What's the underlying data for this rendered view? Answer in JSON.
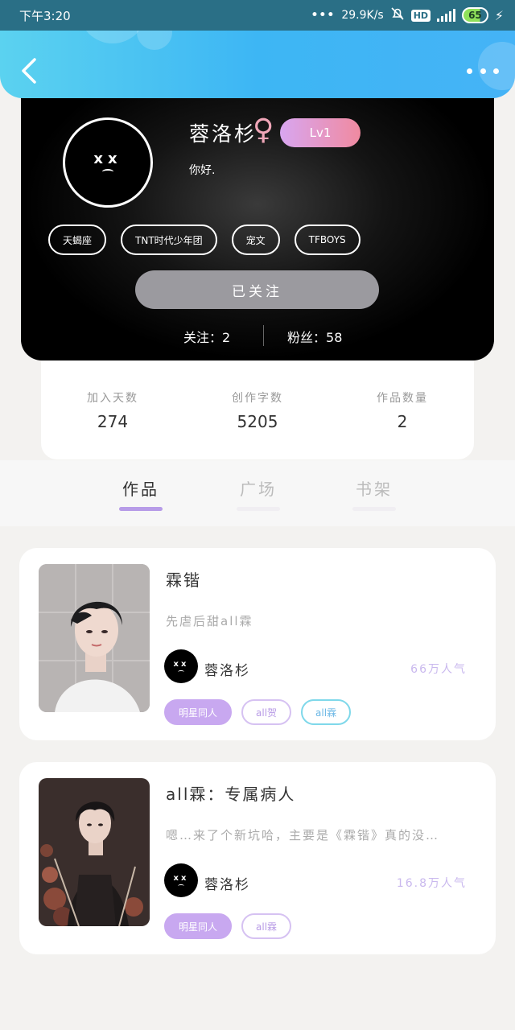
{
  "status_bar": {
    "time": "下午3:20",
    "network_speed": "29.9K/s",
    "hd": "HD",
    "battery": "65"
  },
  "profile": {
    "username": "蓉洛杉",
    "gender_symbol": "♀",
    "level": "Lv1",
    "bio": "你好.",
    "tags": [
      "天蝎座",
      "TNT时代少年团",
      "宠文",
      "TFBOYS"
    ],
    "follow_button": "已关注",
    "following_label": "关注：",
    "following_count": "2",
    "fans_label": "粉丝：",
    "fans_count": "58"
  },
  "stats": [
    {
      "label": "加入天数",
      "value": "274"
    },
    {
      "label": "创作字数",
      "value": "5205"
    },
    {
      "label": "作品数量",
      "value": "2"
    }
  ],
  "tabs": [
    {
      "label": "作品",
      "active": true
    },
    {
      "label": "广场",
      "active": false
    },
    {
      "label": "书架",
      "active": false
    }
  ],
  "works": [
    {
      "title": "霖锴",
      "description": "先虐后甜all霖",
      "author": "蓉洛杉",
      "popularity": "66万人气",
      "tags": [
        "明星同人",
        "all贺",
        "all霖"
      ]
    },
    {
      "title": "all霖：专属病人",
      "description": "嗯…来了个新坑哈，主要是《霖锴》真的没…",
      "author": "蓉洛杉",
      "popularity": "16.8万人气",
      "tags": [
        "明星同人",
        "all霖"
      ]
    }
  ],
  "colors": {
    "header_gradient_start": "#5bd2f0",
    "header_gradient_end": "#45b3f6",
    "accent_purple": "#c8a8f0",
    "level_badge_start": "#d8a6f0",
    "level_badge_end": "#f08aa0"
  }
}
